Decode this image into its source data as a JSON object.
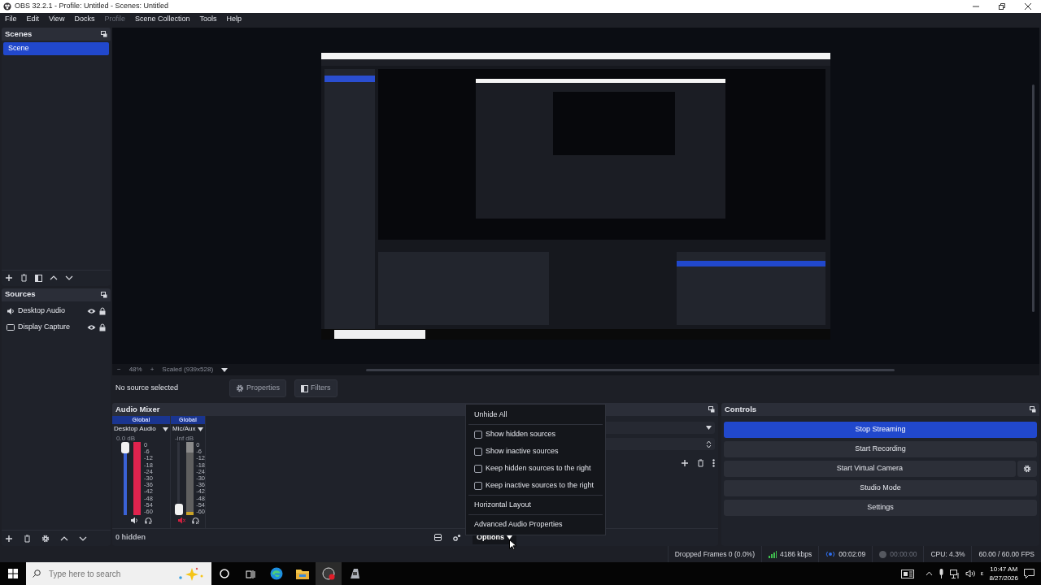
{
  "window": {
    "title": "OBS 32.2.1 - Profile: Untitled - Scenes: Untitled"
  },
  "menu": [
    {
      "label": "File",
      "disabled": false
    },
    {
      "label": "Edit",
      "disabled": false
    },
    {
      "label": "View",
      "disabled": false
    },
    {
      "label": "Docks",
      "disabled": false
    },
    {
      "label": "Profile",
      "disabled": true
    },
    {
      "label": "Scene Collection",
      "disabled": false
    },
    {
      "label": "Tools",
      "disabled": false
    },
    {
      "label": "Help",
      "disabled": false
    }
  ],
  "scenes": {
    "title": "Scenes",
    "items": [
      {
        "label": "Scene",
        "selected": true
      }
    ]
  },
  "sources": {
    "title": "Sources",
    "items": [
      {
        "label": "Desktop Audio",
        "kind": "audio",
        "visible": true
      },
      {
        "label": "Display Capture",
        "kind": "display",
        "visible": true
      }
    ]
  },
  "preview": {
    "kind": "picture",
    "zoom_out": "−",
    "zoom": "48%",
    "zoom_in": "+",
    "scale": "Scaled (939x528)"
  },
  "context_bar": {
    "label": "No source selected",
    "buttons": [
      "Properties",
      "Filters"
    ]
  },
  "audio_mixer": {
    "title": "Audio Mixer",
    "hidden_count": "0 hidden",
    "options_button": "Options",
    "channels": [
      {
        "tag": "Global",
        "name": "Desktop Audio",
        "reading": "0.0 dB",
        "muted": false,
        "fader": {
          "level": 1.0
        },
        "meter": {
          "level": 1.0
        },
        "meter_scale": [
          "0",
          "-6",
          "-12",
          "-18",
          "-24",
          "-30",
          "-36",
          "-42",
          "-48",
          "-54",
          "-60"
        ]
      },
      {
        "tag": "Global",
        "name": "Mic/Aux",
        "reading": "-inf dB",
        "muted": true,
        "fader": {
          "level": 0.0
        },
        "meter": {
          "level": 1.0
        },
        "meter_scale": [
          "0",
          "-6",
          "-12",
          "-18",
          "-24",
          "-30",
          "-36",
          "-42",
          "-48",
          "-54",
          "-60"
        ]
      }
    ]
  },
  "options_menu": {
    "sections": [
      [
        {
          "label": "Unhide All",
          "kind": "action"
        }
      ],
      [
        {
          "label": "Show hidden sources",
          "kind": "check",
          "checked": false
        },
        {
          "label": "Show inactive sources",
          "kind": "check",
          "checked": false
        },
        {
          "label": "Keep hidden sources to the right",
          "kind": "check",
          "checked": false
        },
        {
          "label": "Keep inactive sources to the right",
          "kind": "check",
          "checked": false
        }
      ],
      [
        {
          "label": "Horizontal Layout",
          "kind": "action"
        }
      ],
      [
        {
          "label": "Advanced Audio Properties",
          "kind": "action"
        }
      ]
    ]
  },
  "controls": {
    "title": "Controls",
    "buttons": [
      {
        "label": "Stop Streaming",
        "active": true,
        "settings_button": false
      },
      {
        "label": "Start Recording",
        "active": false,
        "settings_button": false
      },
      {
        "label": "Start Virtual Camera",
        "active": false,
        "settings_button": true
      },
      {
        "label": "Studio Mode",
        "active": false,
        "settings_button": false
      },
      {
        "label": "Settings",
        "active": false,
        "settings_button": false
      }
    ]
  },
  "status_bar": {
    "dropped_frames": "Dropped Frames 0 (0.0%)",
    "bitrate": "4186 kbps",
    "stream_time": "00:02:09",
    "streaming": true,
    "record_time": "00:00:00",
    "recording": false,
    "cpu": "CPU: 4.3%",
    "fps": "60.00 / 60.00 FPS"
  },
  "taskbar": {
    "search": {
      "placeholder": "Type here to search"
    },
    "tray_language": "ε",
    "time": "10:47 AM",
    "date": "8/27/2026"
  }
}
